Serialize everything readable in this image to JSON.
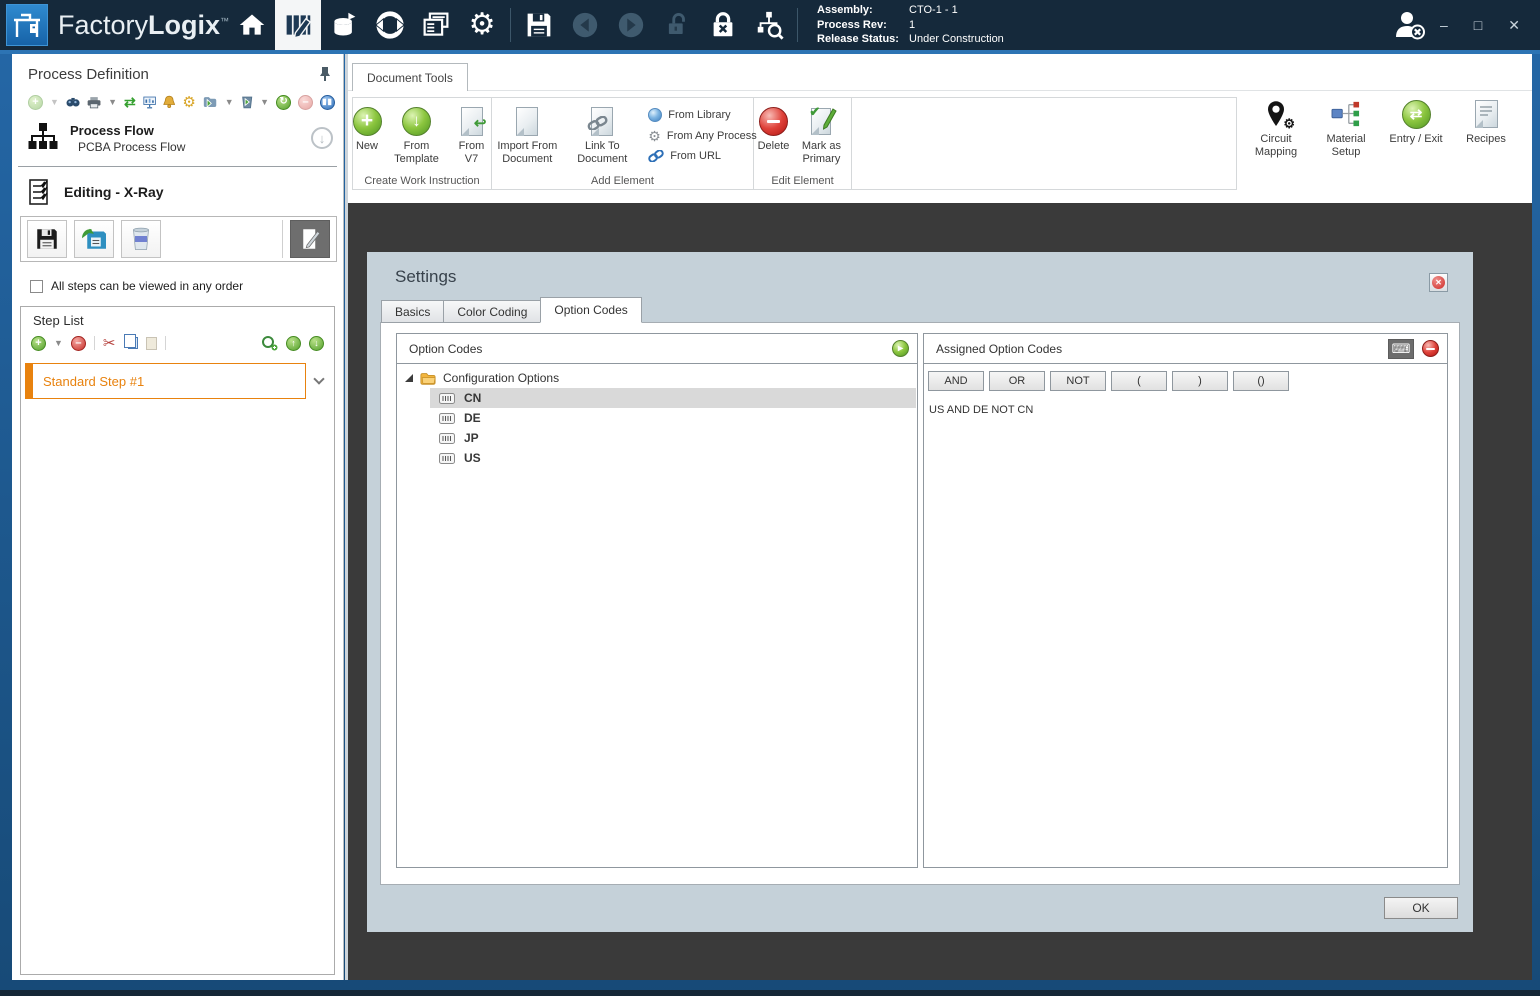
{
  "colors": {
    "accent_blue": "#2d74b4",
    "titlebar_navy": "#15293b",
    "step_orange": "#e8820e",
    "workspace_gray": "#3a3a3a",
    "dialog_bg": "#c5d1d9",
    "selection_gray": "#d9d9d9"
  },
  "titlebar": {
    "brand_light": "Factory",
    "brand_bold": "Logix",
    "brand_tm": "™",
    "info": [
      {
        "label": "Assembly:",
        "value": "CTO-1 - 1"
      },
      {
        "label": "Process Rev:",
        "value": "1"
      },
      {
        "label": "Release Status:",
        "value": "Under Construction"
      }
    ],
    "controls": {
      "minimize": "–",
      "maximize": "□",
      "close": "✕"
    }
  },
  "sidebar": {
    "title": "Process Definition",
    "process_flow": {
      "title": "Process Flow",
      "subtitle": "PCBA Process Flow"
    },
    "editing_label": "Editing - X-Ray",
    "any_order_label": "All steps can be viewed in any order",
    "step_list": {
      "title": "Step List",
      "steps": [
        {
          "label": "Standard Step #1"
        }
      ]
    }
  },
  "ribbon": {
    "tab_label": "Document Tools",
    "groups": [
      {
        "label": "Create Work Instruction",
        "buttons": [
          {
            "label": "New"
          },
          {
            "label": "From Template"
          },
          {
            "label": "From V7"
          }
        ]
      },
      {
        "label": "Add Element",
        "buttons": [
          {
            "label": "Import From Document"
          },
          {
            "label": "Link To Document"
          }
        ],
        "links": [
          {
            "label": "From Library"
          },
          {
            "label": "From Any Process"
          },
          {
            "label": "From URL"
          }
        ]
      },
      {
        "label": "Edit Element",
        "buttons": [
          {
            "label": "Delete"
          },
          {
            "label": "Mark as Primary"
          }
        ]
      }
    ],
    "right_buttons": [
      {
        "label": "Circuit Mapping"
      },
      {
        "label": "Material Setup"
      },
      {
        "label": "Entry / Exit"
      },
      {
        "label": "Recipes"
      }
    ]
  },
  "dialog": {
    "title": "Settings",
    "tabs": [
      {
        "label": "Basics"
      },
      {
        "label": "Color Coding"
      },
      {
        "label": "Option Codes"
      }
    ],
    "option_codes": {
      "title": "Option Codes",
      "root": "Configuration Options",
      "items": [
        {
          "label": "CN"
        },
        {
          "label": "DE"
        },
        {
          "label": "JP"
        },
        {
          "label": "US"
        }
      ]
    },
    "assigned": {
      "title": "Assigned Option Codes",
      "operators": [
        "AND",
        "OR",
        "NOT",
        "(",
        ")",
        "()"
      ],
      "expression": "US AND DE NOT CN"
    },
    "ok_label": "OK"
  }
}
